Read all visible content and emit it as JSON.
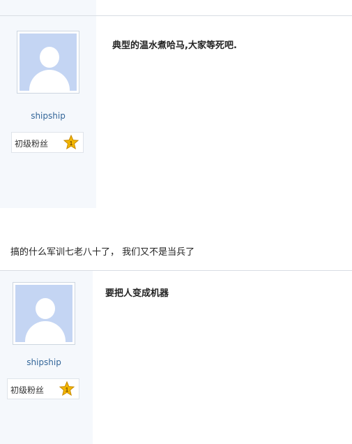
{
  "posts": [
    {
      "username": "shipship",
      "rank": "初级粉丝",
      "level": "1",
      "content": "典型的温水煮哈马,大家等死吧."
    },
    {
      "username": "shipship",
      "rank": "初级粉丝",
      "level": "1",
      "content": "要把人变成机器"
    }
  ],
  "between_text": "搞的什么军训七老八十了， 我们又不是当兵了",
  "colors": {
    "sidebar_bg": "#f5f8fc",
    "avatar_bg": "#c4d5f3",
    "username": "#336699",
    "star": "#f2b600"
  }
}
